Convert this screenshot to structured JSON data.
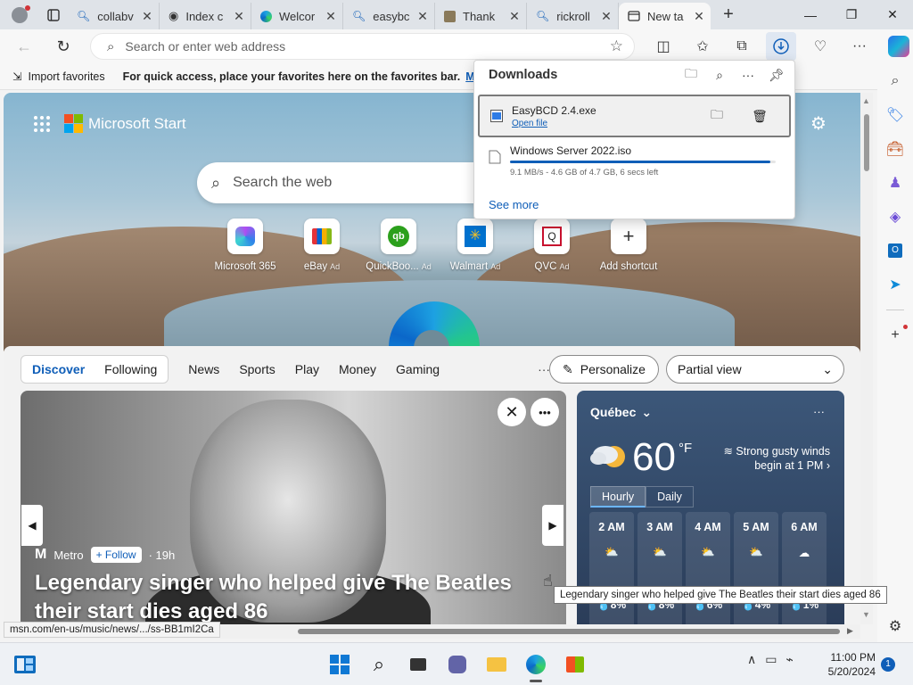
{
  "tabs": [
    {
      "title": "collabv",
      "icon": "search-icon"
    },
    {
      "title": "Index c",
      "icon": "github-icon"
    },
    {
      "title": "Welcor",
      "icon": "edge-icon"
    },
    {
      "title": "easybc",
      "icon": "search-icon"
    },
    {
      "title": "Thank",
      "icon": "page-icon"
    },
    {
      "title": "rickroll",
      "icon": "search-icon"
    },
    {
      "title": "New ta",
      "icon": "newtab-icon"
    }
  ],
  "omnibox": {
    "placeholder": "Search or enter web address"
  },
  "favorites_bar": {
    "import_label": "Import favorites",
    "message": "For quick access, place your favorites here on the favorites bar.",
    "manage_link": "Manage"
  },
  "downloads": {
    "title": "Downloads",
    "items": [
      {
        "name": "EasyBCD 2.4.exe",
        "action": "Open file"
      },
      {
        "name": "Windows Server 2022.iso",
        "status": "9.1 MB/s - 4.6 GB of 4.7 GB, 6 secs left",
        "progress": 0.98
      }
    ],
    "see_more": "See more"
  },
  "start": {
    "brand": "Microsoft Start",
    "search_placeholder": "Search the web",
    "shortcuts": [
      {
        "label": "Microsoft 365",
        "ad": ""
      },
      {
        "label": "eBay",
        "ad": "Ad"
      },
      {
        "label": "QuickBoo...",
        "ad": "Ad"
      },
      {
        "label": "Walmart",
        "ad": "Ad"
      },
      {
        "label": "QVC",
        "ad": "Ad"
      },
      {
        "label": "Add shortcut",
        "ad": ""
      }
    ]
  },
  "feed_nav": {
    "discover": "Discover",
    "following": "Following",
    "links": [
      "News",
      "Sports",
      "Play",
      "Money",
      "Gaming"
    ],
    "more": "···",
    "personalize": "Personalize",
    "view": "Partial view"
  },
  "news": {
    "source": "Metro",
    "follow": "+ Follow",
    "age": "· 19h",
    "headline": "Legendary singer who helped give The Beatles their start dies aged 86"
  },
  "weather": {
    "location": "Québec",
    "temp": "60",
    "unit": "°F",
    "condition": "Strong gusty winds begin at 1 PM",
    "tabs": [
      "Hourly",
      "Daily"
    ],
    "hours": [
      {
        "time": "2 AM",
        "rain": "8%"
      },
      {
        "time": "3 AM",
        "rain": "8%"
      },
      {
        "time": "4 AM",
        "rain": "6%"
      },
      {
        "time": "5 AM",
        "rain": "4%"
      },
      {
        "time": "6 AM",
        "rain": "1%"
      }
    ]
  },
  "status_url": "msn.com/en-us/music/news/.../ss-BB1mI2Ca",
  "tooltip": "Legendary singer who helped give The Beatles their start dies aged 86",
  "clock": {
    "time": "11:00 PM",
    "date": "5/20/2024"
  },
  "notifications": "1",
  "colors": {
    "accent": "#0f5eb8",
    "download_active": "#dfe7f2"
  }
}
